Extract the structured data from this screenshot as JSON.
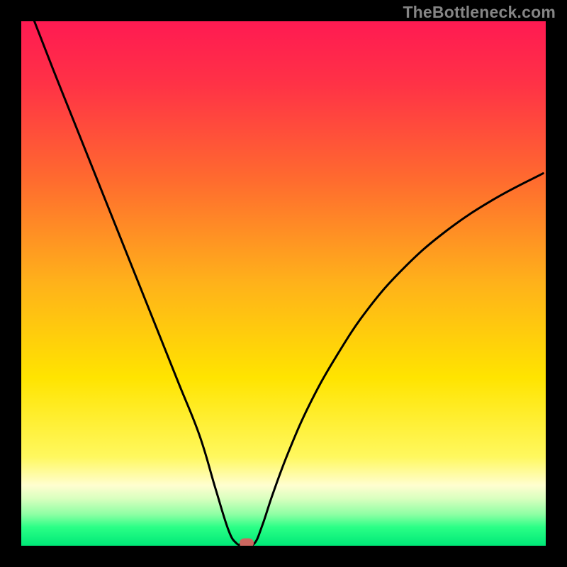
{
  "watermark": "TheBottleneck.com",
  "chart_data": {
    "type": "line",
    "title": "",
    "xlabel": "",
    "ylabel": "",
    "xlim": [
      0,
      100
    ],
    "ylim": [
      0,
      100
    ],
    "gradient_stops": [
      {
        "offset": 0,
        "color": "#ff1a52"
      },
      {
        "offset": 0.12,
        "color": "#ff3246"
      },
      {
        "offset": 0.3,
        "color": "#ff6a2f"
      },
      {
        "offset": 0.5,
        "color": "#ffb21a"
      },
      {
        "offset": 0.68,
        "color": "#ffe400"
      },
      {
        "offset": 0.83,
        "color": "#fff85e"
      },
      {
        "offset": 0.885,
        "color": "#fffed0"
      },
      {
        "offset": 0.91,
        "color": "#d9ffbf"
      },
      {
        "offset": 0.94,
        "color": "#8effa4"
      },
      {
        "offset": 0.965,
        "color": "#2aff86"
      },
      {
        "offset": 1.0,
        "color": "#00e877"
      }
    ],
    "series": [
      {
        "name": "bottleneck-curve-left",
        "x": [
          2.5,
          6,
          10,
          14,
          18,
          22,
          26,
          30,
          34,
          37,
          39.5,
          41
        ],
        "y": [
          100,
          91,
          81,
          71,
          61,
          51,
          41,
          31,
          21,
          11,
          3,
          0.5
        ]
      },
      {
        "name": "bottleneck-curve-right",
        "x": [
          44.5,
          46,
          48,
          51,
          55,
          60,
          66,
          73,
          81,
          90,
          99.5
        ],
        "y": [
          0.5,
          4,
          10,
          18,
          27,
          36,
          45,
          53,
          60,
          66,
          71
        ]
      },
      {
        "name": "bottleneck-curve-bottom",
        "x": [
          41,
          42,
          43,
          44.5
        ],
        "y": [
          0.5,
          0.3,
          0.3,
          0.5
        ]
      }
    ],
    "marker": {
      "x": 43,
      "y": 0.6,
      "color": "#cc6760"
    }
  }
}
